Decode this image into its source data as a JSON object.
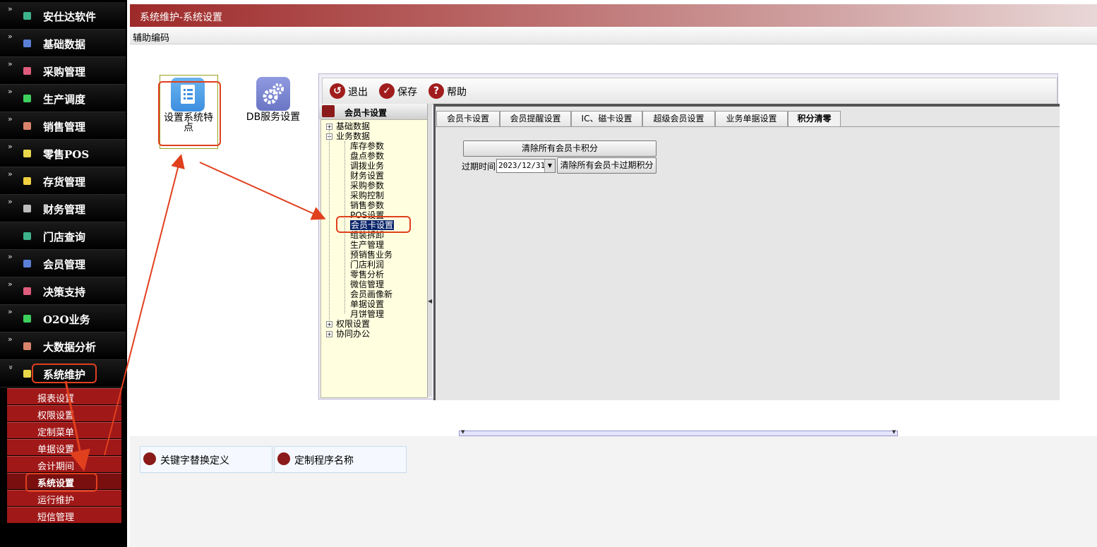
{
  "sidebar": {
    "items": [
      {
        "label": "安仕达软件",
        "chevron": "»"
      },
      {
        "label": "基础数据",
        "chevron": "»"
      },
      {
        "label": "采购管理",
        "chevron": "»"
      },
      {
        "label": "生产调度",
        "chevron": "»"
      },
      {
        "label": "销售管理",
        "chevron": "»"
      },
      {
        "label": "零售POS",
        "chevron": "»"
      },
      {
        "label": "存货管理",
        "chevron": "»"
      },
      {
        "label": "财务管理",
        "chevron": "»"
      },
      {
        "label": "门店查询",
        "chevron": ""
      },
      {
        "label": "会员管理",
        "chevron": "»"
      },
      {
        "label": "决策支持",
        "chevron": "»"
      },
      {
        "label": "O2O业务",
        "chevron": "»"
      },
      {
        "label": "大数据分析",
        "chevron": "»"
      },
      {
        "label": "系统维护",
        "chevron": "»"
      }
    ],
    "sub_items": [
      "报表设置",
      "权限设置",
      "定制菜单",
      "单据设置",
      "会计期间",
      "系统设置",
      "运行维护",
      "短信管理"
    ],
    "active_sub": "系统设置"
  },
  "header": {
    "title": "系统维护-系统设置"
  },
  "subbar": {
    "label": "辅助编码"
  },
  "tiles": [
    {
      "label": "设置系统特点",
      "icon": "document-list-icon"
    },
    {
      "label": "DB服务设置",
      "icon": "gears-icon"
    }
  ],
  "dialog": {
    "toolbar": {
      "exit": "退出",
      "save": "保存",
      "help": "帮助"
    },
    "tree_title": "会员卡设置",
    "tree": {
      "root1": "基础数据",
      "root2": "业务数据",
      "children": [
        "库存参数",
        "盘点参数",
        "调拨业务",
        "财务设置",
        "采购参数",
        "采购控制",
        "销售参数",
        "POS设置",
        "会员卡设置",
        "组装拆卸",
        "生产管理",
        "预销售业务",
        "门店利润",
        "零售分析",
        "微信管理",
        "会员画像新",
        "单据设置",
        "月饼管理"
      ],
      "root3": "权限设置",
      "root4": "协同办公"
    },
    "tabs": [
      "会员卡设置",
      "会员提醒设置",
      "IC、磁卡设置",
      "超级会员设置",
      "业务单据设置",
      "积分清零"
    ],
    "active_tab": "积分清零",
    "clear_all_button": "清除所有会员卡积分",
    "expire_label": "过期时间",
    "expire_date": "2023/12/31",
    "clear_expired_button": "清除所有会员卡过期积分"
  },
  "bottom": {
    "buttons": [
      "关键字替换定义",
      "定制程序名称"
    ]
  },
  "colors": {
    "sidebar_bg": "#000000",
    "sub_item_bg": "#a01818",
    "header_red": "#9e2a2a",
    "annotation_red": "#e0401e"
  }
}
